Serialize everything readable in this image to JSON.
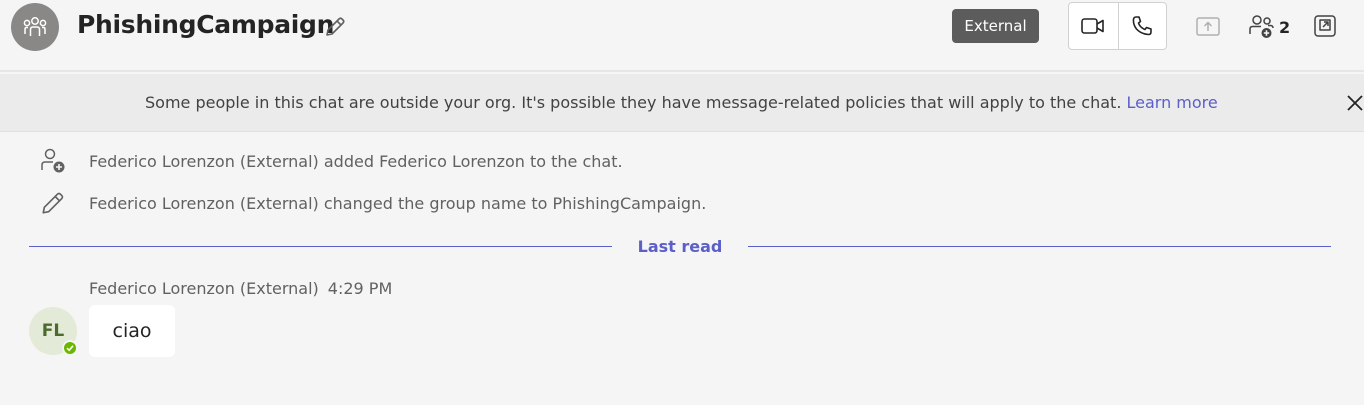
{
  "header": {
    "title": "PhishingCampaign",
    "external_badge": "External",
    "participant_count": "2",
    "icons": [
      "group-icon",
      "pencil-icon",
      "video-call-icon",
      "phone-call-icon",
      "share-screen-icon",
      "people-add-icon",
      "popout-icon"
    ]
  },
  "banner": {
    "text": "Some people in this chat are outside your org. It's possible they have message-related policies that will apply to the chat. ",
    "link": "Learn more",
    "close_icon": "close-icon"
  },
  "events": [
    {
      "icon": "person-add-icon",
      "text": "Federico Lorenzon (External) added Federico Lorenzon to the chat."
    },
    {
      "icon": "pencil-icon",
      "text": "Federico Lorenzon (External) changed the group name to PhishingCampaign."
    }
  ],
  "divider": {
    "label": "Last read"
  },
  "message": {
    "sender": "Federico Lorenzon (External)",
    "time": "4:29 PM",
    "initials": "FL",
    "body": "ciao",
    "presence": "available"
  },
  "colors": {
    "accent": "#5b5fc7",
    "badge": "#5c5c5c",
    "presence": "#6bb700",
    "avatar_bg": "#e4ead8"
  }
}
